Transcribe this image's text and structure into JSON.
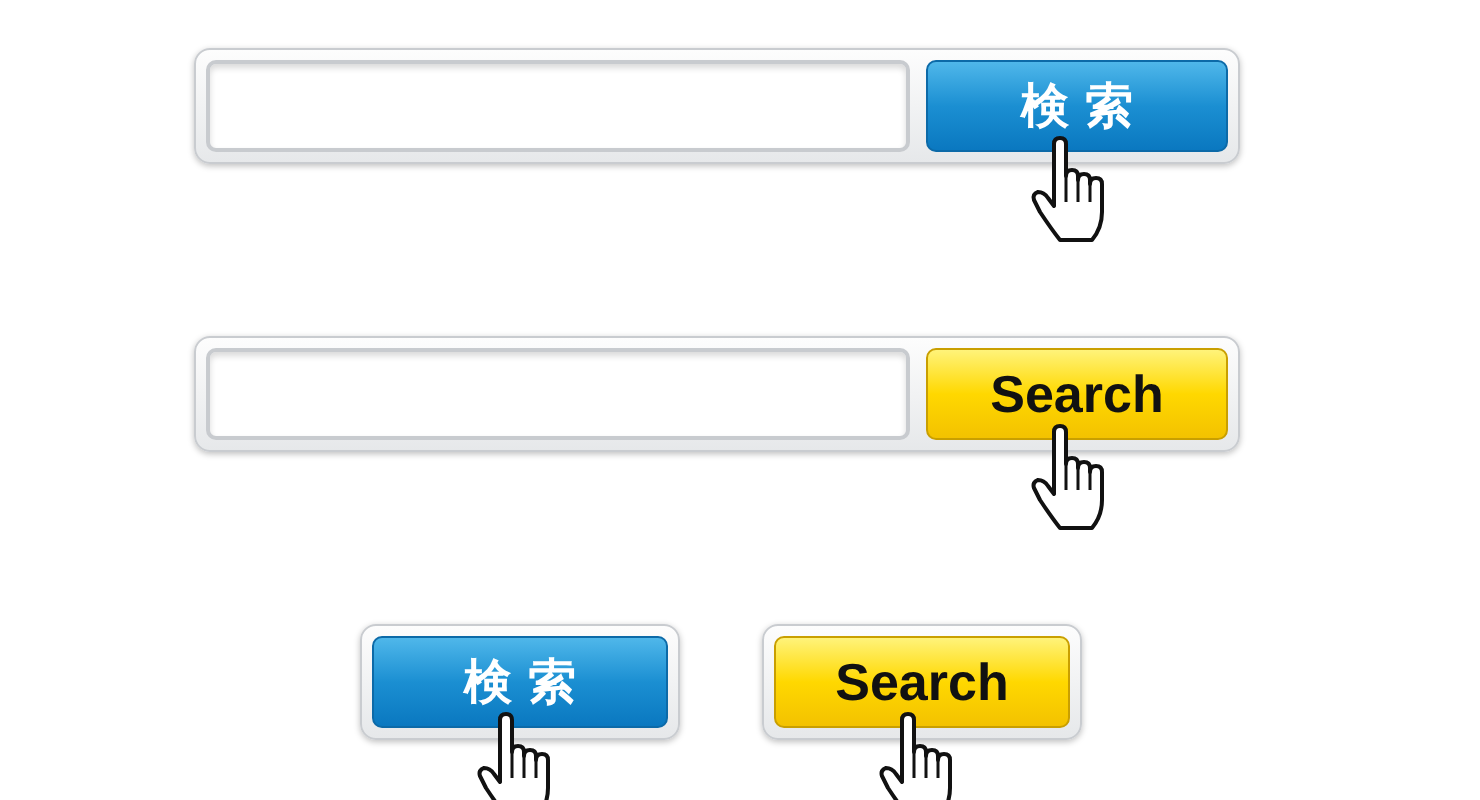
{
  "search_bars": [
    {
      "button": {
        "label": "検 索",
        "kind": "blue"
      }
    },
    {
      "button": {
        "label": "Search",
        "kind": "yellow"
      }
    }
  ],
  "buttons": [
    {
      "label": "検 索",
      "kind": "blue"
    },
    {
      "label": "Search",
      "kind": "yellow"
    }
  ]
}
